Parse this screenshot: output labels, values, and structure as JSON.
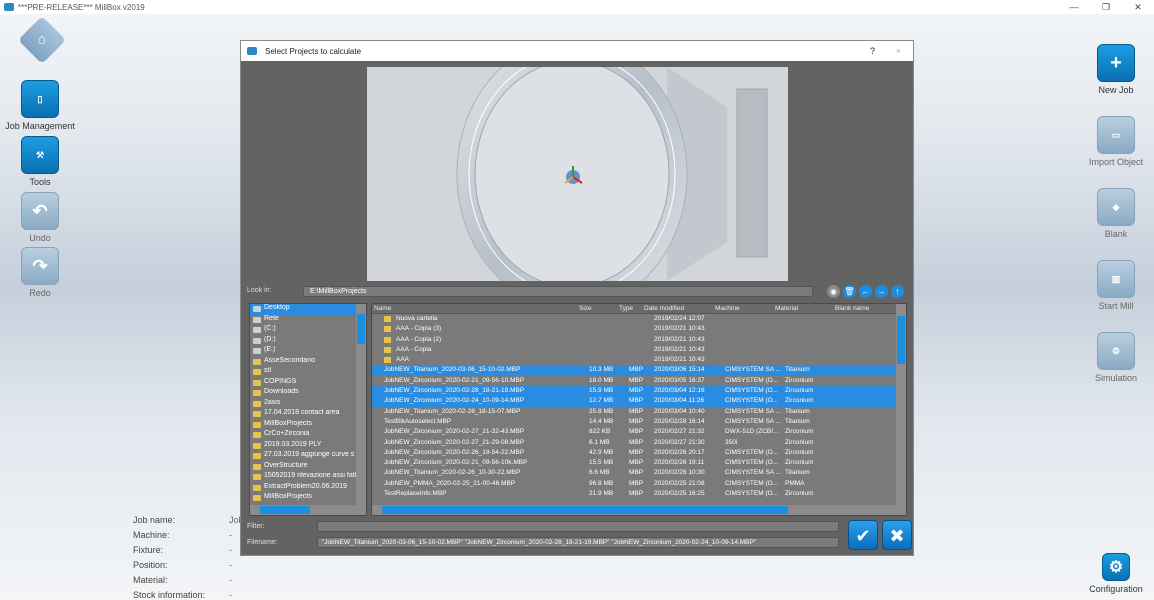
{
  "window": {
    "title": "***PRE-RELEASE*** MillBox v2019"
  },
  "left_toolbar": {
    "home_label": "",
    "job_management_label": "Job Management",
    "tools_label": "Tools",
    "undo_label": "Undo",
    "redo_label": "Redo"
  },
  "right_toolbar": {
    "new_job_label": "New Job",
    "import_object_label": "Import Object",
    "blank_label": "Blank",
    "start_mill_label": "Start Mill",
    "simulation_label": "Simulation",
    "configuration_label": "Configuration"
  },
  "job_info": {
    "job_name_label": "Job name:",
    "job_name_value": "Job",
    "machine_label": "Machine:",
    "fixture_label": "Fixture:",
    "position_label": "Position:",
    "material_label": "Material:",
    "stock_label": "Stock information:",
    "dash": "-"
  },
  "dialog": {
    "title": "Select Projects to calculate",
    "help": "?",
    "close": "×",
    "look_in_label": "Look in:",
    "look_in_value": "E:\\MillBoxProjects",
    "filter_label": "Filter:",
    "filter_value": "",
    "filename_label": "Filename:",
    "filename_value": "\"JobNEW_Titanium_2020-03-06_15-10-02.MBP\" \"JobNEW_Zirconium_2020-02-28_18-21-19.MBP\" \"JobNEW_Zirconium_2020-02-24_10-09-14.MBP\"",
    "ok_glyph": "✔",
    "cancel_glyph": "✖"
  },
  "tree": [
    {
      "label": "Desktop",
      "sel": true,
      "sys": true
    },
    {
      "label": "Rete",
      "sys": true
    },
    {
      "label": "(C:)",
      "sys": true
    },
    {
      "label": "(D:)",
      "sys": true
    },
    {
      "label": "(E:)",
      "sys": true
    },
    {
      "label": "AsseSecondario"
    },
    {
      "label": "stl"
    },
    {
      "label": "COPINGS"
    },
    {
      "label": "Downloads"
    },
    {
      "label": "2axis"
    },
    {
      "label": "17.04.2018 contact area"
    },
    {
      "label": "MillBoxProjects"
    },
    {
      "label": "CrCo+Zirconia"
    },
    {
      "label": "2019.03.2019 PLY"
    },
    {
      "label": "27.03.2019 aggiunge curve s"
    },
    {
      "label": "OverStructure"
    },
    {
      "label": "15052019 rilevazione assi fatt"
    },
    {
      "label": "ExtractProblem20.06.2019"
    },
    {
      "label": "MillBoxProjects"
    }
  ],
  "columns": {
    "name": "Name",
    "size": "Size",
    "type": "Type",
    "date": "Date modified",
    "machine": "Machine",
    "material": "Material",
    "blank": "Blank name"
  },
  "files": [
    {
      "name": "Nuova cartella",
      "size": "",
      "type": "",
      "date": "2019/02/24 12:07",
      "machine": "",
      "material": "",
      "folder": true
    },
    {
      "name": "AAA - Copia (3)",
      "size": "",
      "type": "",
      "date": "2019/02/21 10:43",
      "machine": "",
      "material": "",
      "folder": true
    },
    {
      "name": "AAA - Copia (2)",
      "size": "",
      "type": "",
      "date": "2019/02/21 10:43",
      "machine": "",
      "material": "",
      "folder": true
    },
    {
      "name": "AAA - Copia",
      "size": "",
      "type": "",
      "date": "2019/02/21 10:43",
      "machine": "",
      "material": "",
      "folder": true
    },
    {
      "name": "AAA",
      "size": "",
      "type": "",
      "date": "2019/02/21 10:43",
      "machine": "",
      "material": "",
      "folder": true
    },
    {
      "name": "JobNEW_Titanium_2020-03-06_15-10-02.MBP",
      "size": "10.3 MB",
      "type": "MBP",
      "date": "2020/03/06 15:14",
      "machine": "CIMSYSTEM SA ...",
      "material": "Titanium",
      "sel": true
    },
    {
      "name": "JobNEW_Zirconium_2020-02-21_09-56-10.MBP",
      "size": "18.0 MB",
      "type": "MBP",
      "date": "2020/03/05 16:37",
      "machine": "CIMSYSTEM (O...",
      "material": "Zirconium"
    },
    {
      "name": "JobNEW_Zirconium_2020-02-28_18-21-19.MBP",
      "size": "15.9 MB",
      "type": "MBP",
      "date": "2020/03/04 12:16",
      "machine": "CIMSYSTEM (O...",
      "material": "Zirconium",
      "sel": true
    },
    {
      "name": "JobNEW_Zirconium_2020-02-24_10-09-14.MBP",
      "size": "12.7 MB",
      "type": "MBP",
      "date": "2020/03/04 11:26",
      "machine": "CIMSYSTEM (O...",
      "material": "Zirconium",
      "sel": true
    },
    {
      "name": "JobNEW_Titanium_2020-02-28_18-15-07.MBP",
      "size": "25.8 MB",
      "type": "MBP",
      "date": "2020/03/04 10:40",
      "machine": "CIMSYSTEM SA ...",
      "material": "Titanium"
    },
    {
      "name": "TestBlkAutoselect.MBP",
      "size": "14.4 MB",
      "type": "MBP",
      "date": "2020/02/28 16:14",
      "machine": "CIMSYSTEM SA ...",
      "material": "Titanium"
    },
    {
      "name": "JobNEW_Zirconium_2020-02-27_21-32-43.MBP",
      "size": "822 KB",
      "type": "MBP",
      "date": "2020/02/27 21:32",
      "machine": "DWX-51D (ZCB/...",
      "material": "Zirconium"
    },
    {
      "name": "JobNEW_Zirconium_2020-02-27_21-29-08.MBP",
      "size": "6.1 MB",
      "type": "MBP",
      "date": "2020/02/27 21:30",
      "machine": "350i",
      "material": "Zirconium"
    },
    {
      "name": "JobNEW_Zirconium_2020-02-26_19-54-22.MBP",
      "size": "42.9 MB",
      "type": "MBP",
      "date": "2020/02/26 20:17",
      "machine": "CIMSYSTEM (O...",
      "material": "Zirconium"
    },
    {
      "name": "JobNEW_Zirconium_2020-02-21_09-56-10k.MBP",
      "size": "15.5 MB",
      "type": "MBP",
      "date": "2020/02/26 19:11",
      "machine": "CIMSYSTEM (O...",
      "material": "Zirconium"
    },
    {
      "name": "JobNEW_Titanium_2020-02-26_10-30-22.MBP",
      "size": "6.6 MB",
      "type": "MBP",
      "date": "2020/02/26 10:30",
      "machine": "CIMSYSTEM SA ...",
      "material": "Titanium"
    },
    {
      "name": "JobNEW_PMMA_2020-02-25_21-00-46.MBP",
      "size": "96.8 MB",
      "type": "MBP",
      "date": "2020/02/25 21:08",
      "machine": "CIMSYSTEM (O...",
      "material": "PMMA"
    },
    {
      "name": "TestReplaceInfo.MBP",
      "size": "21.9 MB",
      "type": "MBP",
      "date": "2020/02/25 16:25",
      "machine": "CIMSYSTEM (O...",
      "material": "Zirconium"
    }
  ],
  "colors": {
    "accent": "#1a8fe0",
    "dialog_bg": "#636363",
    "selected_row": "#2a8ce0"
  }
}
